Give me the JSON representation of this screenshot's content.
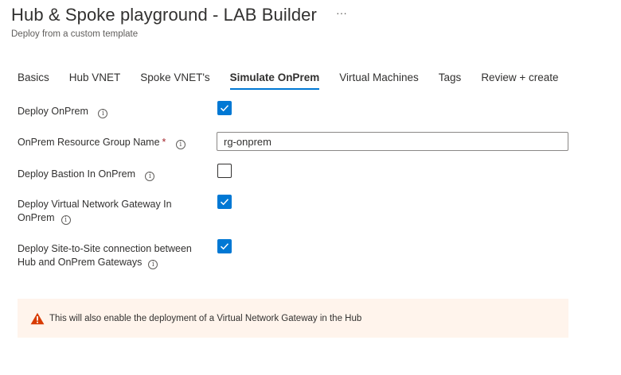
{
  "header": {
    "title": "Hub & Spoke playground - LAB Builder",
    "more_glyph": "···",
    "subtitle": "Deploy from a custom template"
  },
  "tabs": [
    {
      "label": "Basics",
      "active": false
    },
    {
      "label": "Hub VNET",
      "active": false
    },
    {
      "label": "Spoke VNET's",
      "active": false
    },
    {
      "label": "Simulate OnPrem",
      "active": true
    },
    {
      "label": "Virtual Machines",
      "active": false
    },
    {
      "label": "Tags",
      "active": false
    },
    {
      "label": "Review + create",
      "active": false
    }
  ],
  "form": {
    "deploy_onprem": {
      "label": "Deploy OnPrem",
      "checked": true
    },
    "rg_name": {
      "label": "OnPrem Resource Group Name",
      "required_mark": "*",
      "value": "rg-onprem"
    },
    "deploy_bastion": {
      "label": "Deploy Bastion In OnPrem",
      "checked": false
    },
    "deploy_vng": {
      "label_line1": "Deploy Virtual Network Gateway In",
      "label_line2": "OnPrem",
      "checked": true
    },
    "deploy_s2s": {
      "label_line1": "Deploy Site-to-Site connection between",
      "label_line2": "Hub and OnPrem Gateways",
      "checked": true
    }
  },
  "banner": {
    "icon": "warning-icon",
    "text": "This will also enable the deployment of a Virtual Network Gateway in the Hub",
    "color": "#d83b01"
  },
  "info_glyph": "i",
  "colors": {
    "accent": "#0078d4",
    "banner_bg": "#fff4ec",
    "required": "#a4262c"
  }
}
